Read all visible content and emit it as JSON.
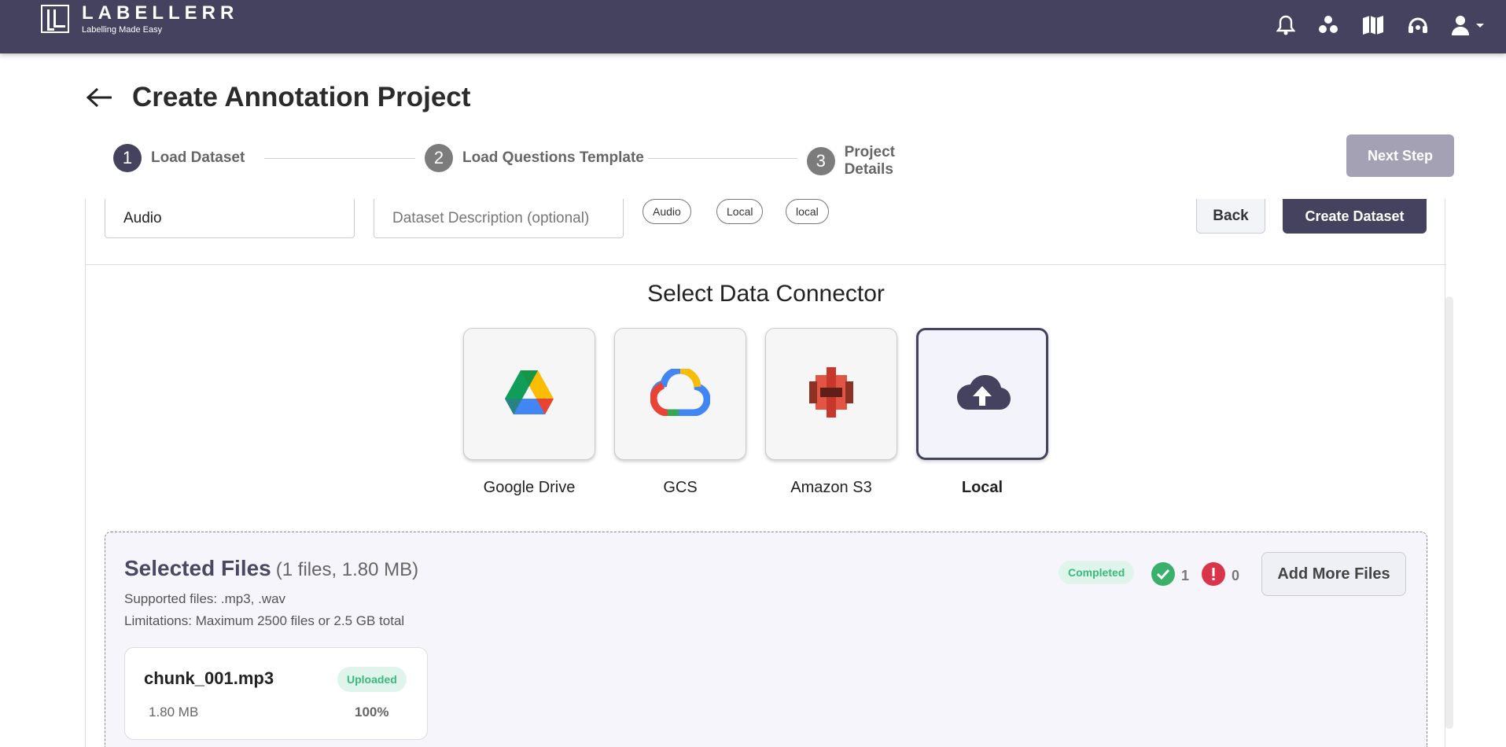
{
  "brand": {
    "name": "LABELLERR",
    "tagline": "Labelling Made Easy"
  },
  "header_icons": [
    "bell-icon",
    "team-icon",
    "book-icon",
    "support-icon",
    "user-icon"
  ],
  "page": {
    "title": "Create Annotation Project"
  },
  "steps": [
    {
      "num": "1",
      "label": "Load Dataset"
    },
    {
      "num": "2",
      "label": "Load Questions Template"
    },
    {
      "num": "3",
      "label": "Project Details"
    }
  ],
  "next_step_label": "Next Step",
  "dataset": {
    "name_value": "Audio",
    "description_placeholder": "Dataset Description (optional)",
    "tags": [
      "Audio",
      "Local",
      "local"
    ],
    "back_label": "Back",
    "create_label": "Create Dataset"
  },
  "connector": {
    "title": "Select Data Connector",
    "items": [
      {
        "label": "Google Drive",
        "icon": "google-drive-icon"
      },
      {
        "label": "GCS",
        "icon": "google-cloud-icon"
      },
      {
        "label": "Amazon S3",
        "icon": "amazon-s3-icon"
      },
      {
        "label": "Local",
        "icon": "cloud-upload-icon",
        "selected": true
      }
    ]
  },
  "files": {
    "heading": "Selected Files",
    "count": "(1 files, 1.80 MB)",
    "supported": "Supported files: .mp3, .wav",
    "limitations": "Limitations: Maximum 2500 files or 2.5 GB total",
    "status": "Completed",
    "success_count": "1",
    "error_count": "0",
    "add_more_label": "Add More Files",
    "list": [
      {
        "name": "chunk_001.mp3",
        "size": "1.80 MB",
        "status": "Uploaded",
        "progress": "100%"
      }
    ]
  },
  "colors": {
    "primary": "#45425f",
    "success": "#3bb97b",
    "error": "#d9344a"
  }
}
